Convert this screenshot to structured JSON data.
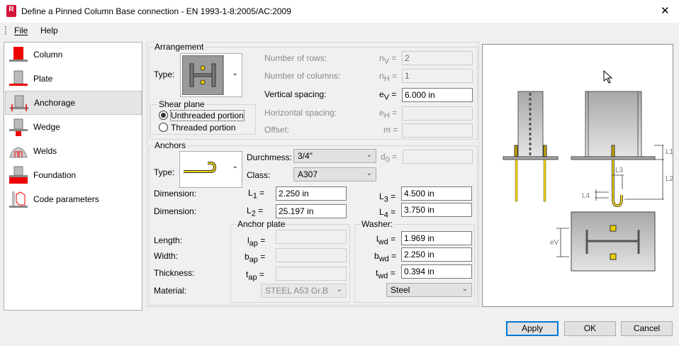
{
  "window": {
    "title": "Define a Pinned Column Base connection - EN 1993-1-8:2005/AC:2009",
    "app_icon": "R",
    "close": "✕"
  },
  "menu": {
    "file": "File",
    "help": "Help"
  },
  "sidebar": {
    "items": [
      {
        "label": "Column",
        "icon": "column-icon"
      },
      {
        "label": "Plate",
        "icon": "plate-icon"
      },
      {
        "label": "Anchorage",
        "icon": "anchorage-icon",
        "selected": true
      },
      {
        "label": "Wedge",
        "icon": "wedge-icon"
      },
      {
        "label": "Welds",
        "icon": "welds-icon"
      },
      {
        "label": "Foundation",
        "icon": "foundation-icon"
      },
      {
        "label": "Code parameters",
        "icon": "code-parameters-icon"
      }
    ]
  },
  "arrangement": {
    "title": "Arrangement",
    "type_label": "Type:",
    "shear_plane": {
      "title": "Shear plane",
      "options": [
        "Unthreaded portion",
        "Threaded portion"
      ],
      "selected": "Unthreaded portion"
    },
    "rows": {
      "label": "Number of rows:",
      "symbol": "n",
      "sub": "V",
      "value": "2"
    },
    "columns": {
      "label": "Number of columns:",
      "symbol": "n",
      "sub": "H",
      "value": "1"
    },
    "vspacing": {
      "label": "Vertical spacing:",
      "symbol": "e",
      "sub": "V",
      "value": "6.000 in"
    },
    "hspacing": {
      "label": "Horizontal spacing:",
      "symbol": "e",
      "sub": "H",
      "value": ""
    },
    "offset": {
      "label": "Offset:",
      "symbol": "m",
      "value": ""
    }
  },
  "anchors": {
    "title": "Anchors",
    "type_label": "Type:",
    "diameter": {
      "label": "Durchmess:",
      "value": "3/4\""
    },
    "d0": {
      "symbol": "d",
      "sub": "0",
      "value": ""
    },
    "class": {
      "label": "Class:",
      "value": "A307"
    },
    "dimension_label": "Dimension:",
    "L1": {
      "symbol": "L",
      "sub": "1",
      "value": "2.250 in"
    },
    "L2": {
      "symbol": "L",
      "sub": "2",
      "value": "25.197 in"
    },
    "L3": {
      "symbol": "L",
      "sub": "3",
      "value": "4.500 in"
    },
    "L4": {
      "symbol": "L",
      "sub": "4",
      "value": "3.750 in"
    },
    "length_label": "Length:",
    "width_label": "Width:",
    "thickness_label": "Thickness:",
    "material_label": "Material:",
    "anchor_plate": {
      "title": "Anchor plate",
      "lap": {
        "symbol": "l",
        "sub": "ap",
        "value": ""
      },
      "bap": {
        "symbol": "b",
        "sub": "ap",
        "value": ""
      },
      "tap": {
        "symbol": "t",
        "sub": "ap",
        "value": ""
      },
      "material": "STEEL A53 Gr.B"
    },
    "washer": {
      "title": "Washer:",
      "lwd": {
        "symbol": "l",
        "sub": "wd",
        "value": "1.969 in"
      },
      "bwd": {
        "symbol": "b",
        "sub": "wd",
        "value": "2.250 in"
      },
      "twd": {
        "symbol": "t",
        "sub": "wd",
        "value": "0.394 in"
      },
      "material": "Steel"
    }
  },
  "drawing": {
    "labels": {
      "L1": "L1",
      "L2": "L2",
      "L3": "L3",
      "L4": "L4",
      "eV": "eV"
    }
  },
  "buttons": {
    "apply": "Apply",
    "ok": "OK",
    "cancel": "Cancel"
  },
  "colors": {
    "accent": "#0078d7",
    "bolt": "#f0d000",
    "highlight": "#e00000"
  }
}
